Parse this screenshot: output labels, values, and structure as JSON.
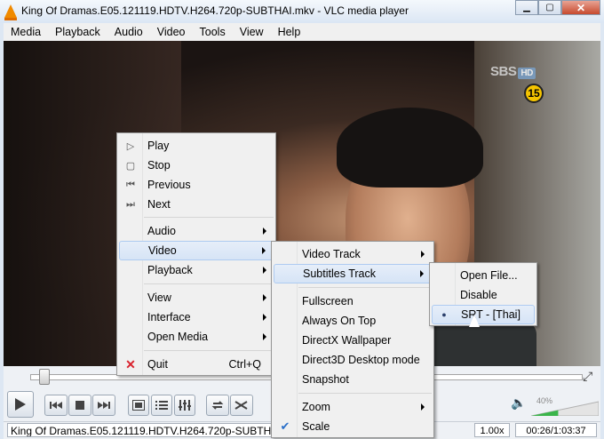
{
  "window": {
    "title": "King Of Dramas.E05.121119.HDTV.H264.720p-SUBTHAI.mkv - VLC media player",
    "minimize": "▁",
    "maximize": "▢",
    "close": "✕"
  },
  "menubar": [
    "Media",
    "Playback",
    "Audio",
    "Video",
    "Tools",
    "View",
    "Help"
  ],
  "video": {
    "channel_logo": "SBS",
    "channel_logo_hd": "HD",
    "rating": "15"
  },
  "context_menu": {
    "play": "Play",
    "stop": "Stop",
    "previous": "Previous",
    "next": "Next",
    "audio": "Audio",
    "video": "Video",
    "playback": "Playback",
    "view": "View",
    "interface": "Interface",
    "open_media": "Open Media",
    "quit": "Quit",
    "quit_shortcut": "Ctrl+Q"
  },
  "video_submenu": {
    "video_track": "Video Track",
    "subtitles_track": "Subtitles Track",
    "fullscreen": "Fullscreen",
    "always_on_top": "Always On Top",
    "directx_wallpaper": "DirectX Wallpaper",
    "direct3d_desktop": "Direct3D Desktop mode",
    "snapshot": "Snapshot",
    "zoom": "Zoom",
    "scale": "Scale"
  },
  "subtitles_submenu": {
    "open_file": "Open File...",
    "disable": "Disable",
    "srt_thai": "SRT - [Thai]"
  },
  "controls": {
    "volume_percent": "40%",
    "volume_level": 0.4,
    "seek_position": 0.016
  },
  "status": {
    "filename": "King Of Dramas.E05.121119.HDTV.H264.720p-SUBTHAI.mkv",
    "speed": "1.00x",
    "time": "00:26/1:03:37"
  },
  "colors": {
    "vlc_orange": "#f08a00",
    "menu_highlight": "#d6e4f6",
    "quit_icon": "#d9232e",
    "rating_badge": "#f5c400"
  }
}
